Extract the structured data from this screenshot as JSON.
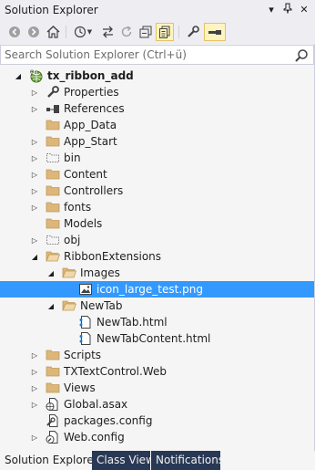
{
  "window": {
    "title": "Solution Explorer",
    "pin_glyph": "▾",
    "autohide_glyph": "⊣",
    "close_glyph": "✕"
  },
  "toolbar": {
    "back_icon": "back-icon",
    "forward_icon": "forward-icon",
    "home_icon": "home-icon",
    "pending_changes_filter_icon": "history-icon",
    "sync_icon": "sync-with-document-icon",
    "refresh_icon": "refresh-icon",
    "collapse_icon": "collapse-all-icon",
    "show_all_files_icon": "show-all-files-icon",
    "properties_icon": "wrench-icon",
    "preview_icon": "preview-selected-icon"
  },
  "search": {
    "placeholder": "Search Solution Explorer (Ctrl+ü)"
  },
  "tree": [
    {
      "label": "tx_ribbon_add",
      "icon": "web-project-icon",
      "state": "expanded",
      "bold": true
    },
    {
      "label": "Properties",
      "icon": "wrench-icon",
      "state": "collapsed"
    },
    {
      "label": "References",
      "icon": "references-icon",
      "state": "collapsed"
    },
    {
      "label": "App_Data",
      "icon": "folder-icon",
      "state": "none"
    },
    {
      "label": "App_Start",
      "icon": "folder-icon",
      "state": "collapsed"
    },
    {
      "label": "bin",
      "icon": "hidden-folder-icon",
      "state": "collapsed"
    },
    {
      "label": "Content",
      "icon": "folder-icon",
      "state": "collapsed"
    },
    {
      "label": "Controllers",
      "icon": "folder-icon",
      "state": "collapsed"
    },
    {
      "label": "fonts",
      "icon": "folder-icon",
      "state": "collapsed"
    },
    {
      "label": "Models",
      "icon": "folder-icon",
      "state": "none"
    },
    {
      "label": "obj",
      "icon": "hidden-folder-icon",
      "state": "collapsed"
    },
    {
      "label": "RibbonExtensions",
      "icon": "open-folder-icon",
      "state": "expanded"
    },
    {
      "label": "Images",
      "icon": "open-folder-icon",
      "state": "expanded"
    },
    {
      "label": "icon_large_test.png",
      "icon": "image-file-icon",
      "state": "none",
      "selected": true
    },
    {
      "label": "NewTab",
      "icon": "open-folder-icon",
      "state": "expanded"
    },
    {
      "label": "NewTab.html",
      "icon": "html-file-icon",
      "state": "none"
    },
    {
      "label": "NewTabContent.html",
      "icon": "html-file-icon",
      "state": "none"
    },
    {
      "label": "Scripts",
      "icon": "folder-icon",
      "state": "collapsed"
    },
    {
      "label": "TXTextControl.Web",
      "icon": "folder-icon",
      "state": "collapsed"
    },
    {
      "label": "Views",
      "icon": "folder-icon",
      "state": "collapsed"
    },
    {
      "label": "Global.asax",
      "icon": "global-asax-icon",
      "state": "collapsed"
    },
    {
      "label": "packages.config",
      "icon": "config-file-icon",
      "state": "none"
    },
    {
      "label": "Web.config",
      "icon": "web-config-icon",
      "state": "collapsed"
    }
  ],
  "tabs": [
    {
      "label": "Solution Explorer",
      "active": true
    },
    {
      "label": "Class View",
      "active": false
    },
    {
      "label": "Notifications",
      "active": false
    }
  ],
  "colors": {
    "selection": "#3399ff",
    "folder": "#dcb67a",
    "background": "#f5f5f5",
    "toolbar": "#eeeef2"
  }
}
